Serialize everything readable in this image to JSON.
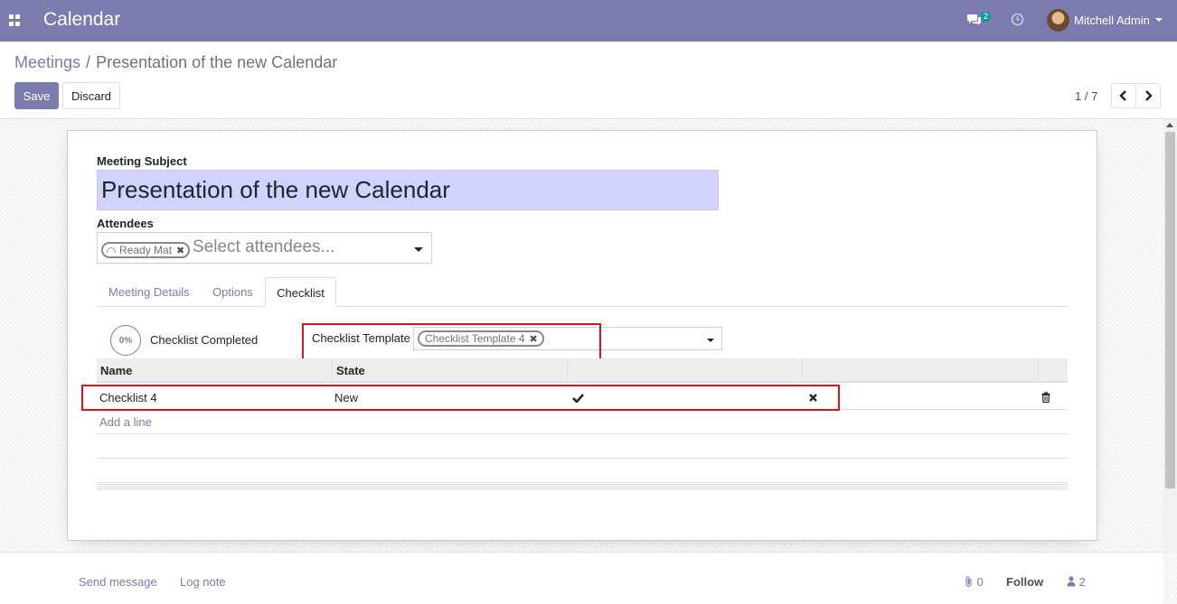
{
  "navbar": {
    "apps_icon": "apps-grid-icon",
    "app_title": "Calendar",
    "messages_icon": "chat-bubbles-icon",
    "messages_count": "2",
    "activities_icon": "clock-icon",
    "user_name": "Mitchell Admin",
    "color": "#7c7bad"
  },
  "breadcrumb": {
    "parent": "Meetings",
    "separator": "/",
    "current": "Presentation of the new Calendar"
  },
  "toolbar": {
    "save_label": "Save",
    "discard_label": "Discard"
  },
  "pager": {
    "value": "1 / 7"
  },
  "form": {
    "subject_label": "Meeting Subject",
    "subject_value": "Presentation of the new Calendar",
    "attendees_label": "Attendees",
    "attendee_tags": [
      "Ready Mat"
    ],
    "attendees_placeholder": "Select attendees...",
    "tabs": [
      {
        "label": "Meeting Details",
        "active": false
      },
      {
        "label": "Options",
        "active": false
      },
      {
        "label": "Checklist",
        "active": true
      }
    ],
    "checklist": {
      "progress": "0%",
      "progress_label": "Checklist Completed",
      "template_label": "Checklist Template",
      "template_tag": "Checklist Template 4",
      "columns": [
        "Name",
        "State",
        "",
        ""
      ],
      "rows": [
        {
          "name": "Checklist 4",
          "state": "New",
          "done_icon": "check-icon",
          "cancel_icon": "times-icon",
          "delete_icon": "trash-icon"
        }
      ],
      "add_line": "Add a line"
    }
  },
  "chatter": {
    "send_message": "Send message",
    "log_note": "Log note",
    "attachments_count": "0",
    "follow": "Follow",
    "followers_count": "2"
  },
  "colors": {
    "accent": "#7c7bad",
    "highlight_border": "#d9141e",
    "subject_bg": "#d2d2ff"
  }
}
